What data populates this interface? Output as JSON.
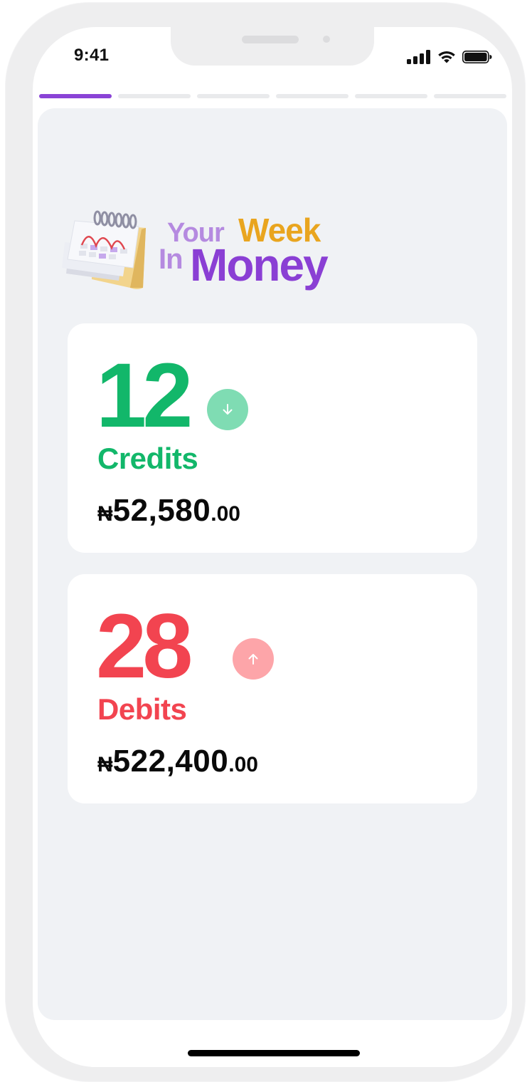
{
  "status_bar": {
    "time": "9:41",
    "icons": [
      "cellular-signal-icon",
      "wifi-icon",
      "battery-icon"
    ]
  },
  "story_progress": {
    "total_segments": 6,
    "active_index": 0
  },
  "hero": {
    "title_your": "Your",
    "title_week": "Week",
    "title_in": "In",
    "title_money": "Money",
    "illustration": "calendar-illustration"
  },
  "credits_card": {
    "count": "12",
    "label": "Credits",
    "currency": "₦",
    "amount_whole": "52,580",
    "amount_fraction": ".00",
    "direction_icon": "arrow-down-icon",
    "color": "#12b76a",
    "badge_color": "#7fdcb3"
  },
  "debits_card": {
    "count": "28",
    "label": "Debits",
    "currency": "₦",
    "amount_whole": "522,400",
    "amount_fraction": ".00",
    "direction_icon": "arrow-up-icon",
    "color": "#f24450",
    "badge_color": "#fda5a9"
  },
  "colors": {
    "accent_purple": "#8a43d6",
    "week_gold": "#e9a51f",
    "panel_background": "#f0f2f5"
  }
}
